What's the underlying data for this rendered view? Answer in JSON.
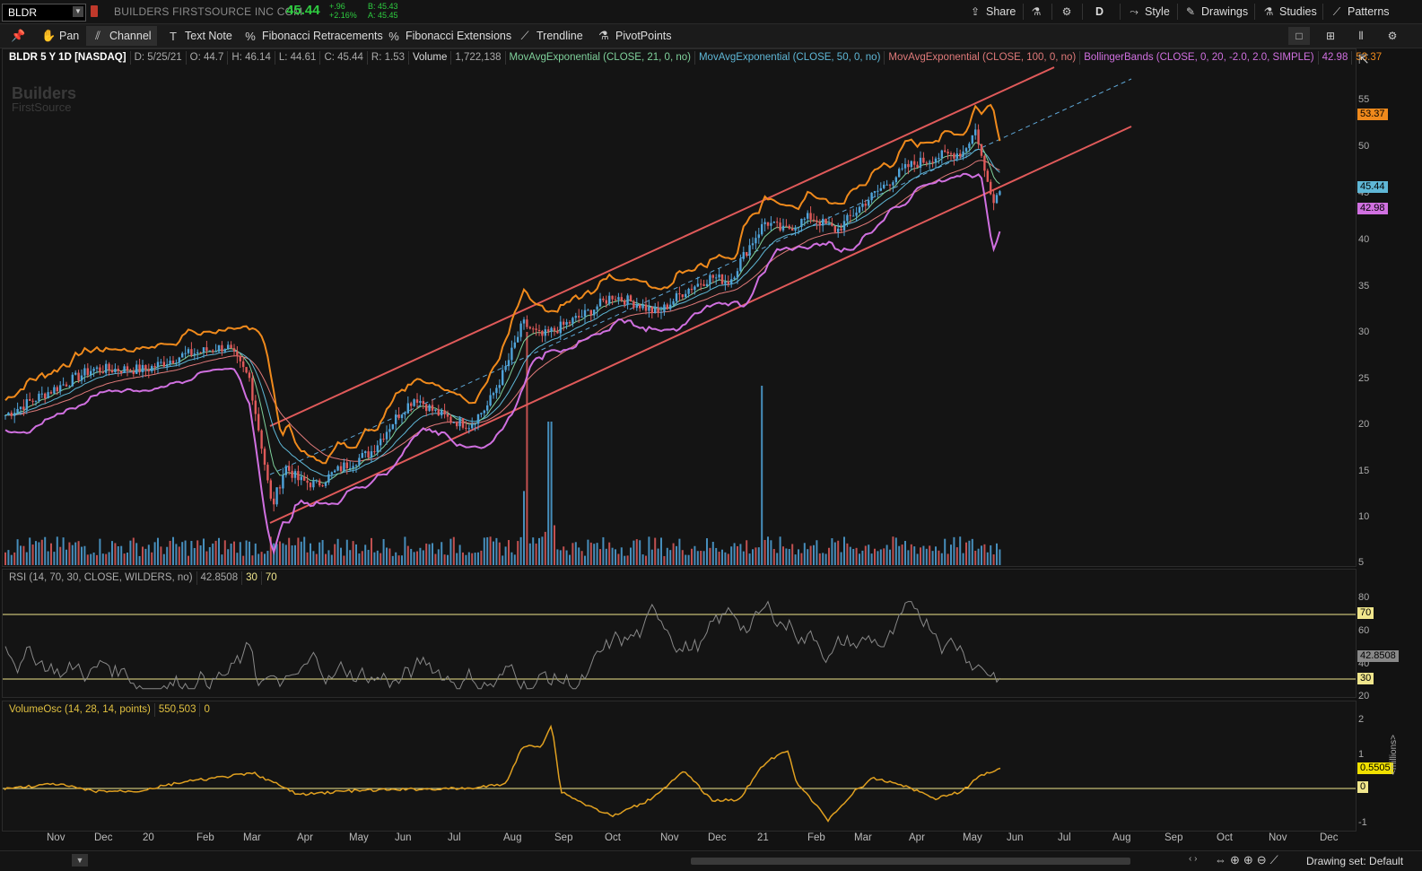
{
  "header": {
    "symbol": "BLDR",
    "company": "BUILDERS FIRSTSOURCE INC COM",
    "last": "45.44",
    "change_abs": "+.96",
    "change_pct": "+2.16%",
    "bid": "B: 45.43",
    "ask": "A: 45.45",
    "share_label": "Share",
    "aggregation": "D",
    "style_label": "Style",
    "drawings_label": "Drawings",
    "studies_label": "Studies",
    "patterns_label": "Patterns"
  },
  "tools": {
    "pan": "Pan",
    "channel": "Channel",
    "text_note": "Text Note",
    "fib_retracements": "Fibonacci Retracements",
    "fib_extensions": "Fibonacci Extensions",
    "trendline": "Trendline",
    "pivotpoints": "PivotPoints"
  },
  "legend": {
    "title": "BLDR 5 Y 1D [NASDAQ]",
    "date": "D: 5/25/21",
    "open": "O: 44.7",
    "high": "H: 46.14",
    "low": "L: 44.61",
    "close": "C: 45.44",
    "range": "R: 1.53",
    "volume_label": "Volume",
    "volume_value": "1,722,138",
    "ema21": "MovAvgExponential (CLOSE, 21, 0, no)",
    "ema50": "MovAvgExponential (CLOSE, 50, 0, no)",
    "ema100": "MovAvgExponential (CLOSE, 100, 0, no)",
    "bb": "BollingerBands (CLOSE, 0, 20, -2.0, 2.0, SIMPLE)",
    "bb_lower": "42.98",
    "bb_upper": "53.37"
  },
  "logo": {
    "line1": "Builders",
    "line2": "FirstSource"
  },
  "price_axis": [
    "55",
    "50",
    "45",
    "40",
    "35",
    "30",
    "25",
    "20",
    "15",
    "10",
    "5"
  ],
  "price_tags": {
    "upper": "53.37",
    "last": "45.44",
    "lower": "42.98"
  },
  "rsi": {
    "label": "RSI (14, 70, 30, CLOSE, WILDERS, no)",
    "value": "42.8508",
    "os": "30",
    "ob": "70",
    "axis": [
      "80",
      "60",
      "40",
      "20"
    ],
    "tag_ob": "70",
    "tag_value": "42.8508",
    "tag_os": "30"
  },
  "volosc": {
    "label": "VolumeOsc (14, 28, 14, points)",
    "value": "550,503",
    "zero": "0",
    "axis": [
      "2",
      "1",
      "0",
      "-1"
    ],
    "tag_value": "0.5505",
    "tag_zero": "0",
    "unit": "<millions>"
  },
  "x_axis": [
    "Nov",
    "Dec",
    "20",
    "Feb",
    "Mar",
    "Apr",
    "May",
    "Jun",
    "Jul",
    "Aug",
    "Sep",
    "Oct",
    "Nov",
    "Dec",
    "21",
    "Feb",
    "Mar",
    "Apr",
    "May",
    "Jun",
    "Jul",
    "Aug",
    "Sep",
    "Oct",
    "Nov",
    "Dec"
  ],
  "footer": {
    "drawing_set": "Drawing set: Default"
  },
  "colors": {
    "up": "#4fa3d9",
    "down": "#e05a5a",
    "ema21": "#7fd19b",
    "ema50": "#5fb7d6",
    "ema100": "#e07a7a",
    "bb_upper": "#f08a1c",
    "bb_lower": "#d070e0",
    "channel": "#e05a5a",
    "rsi": "#888888",
    "volosc": "#e0a020"
  }
}
